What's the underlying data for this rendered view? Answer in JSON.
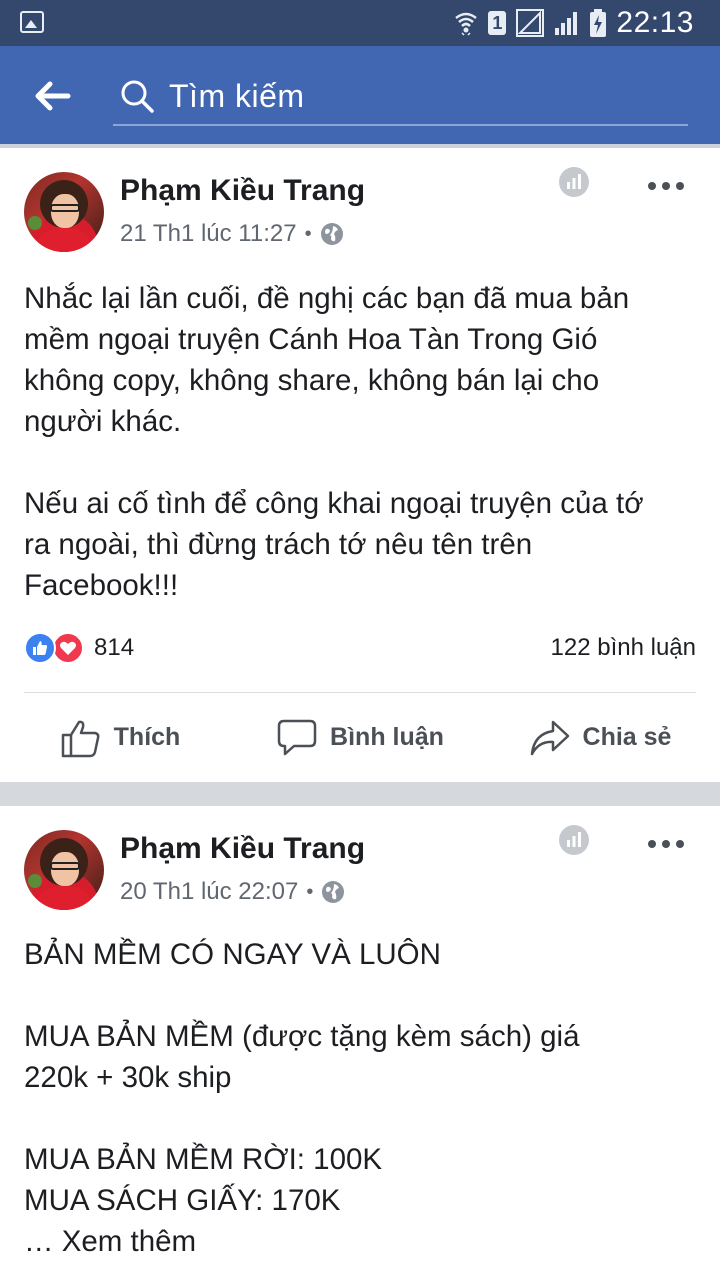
{
  "status_bar": {
    "time": "22:13",
    "sim_label": "1",
    "icons": [
      "gallery-icon",
      "wifi-icon",
      "sim-icon",
      "signal-icon",
      "signal-icon",
      "battery-charging-icon"
    ]
  },
  "header": {
    "back_icon": "arrow-left-icon",
    "search_icon": "search-icon",
    "search_placeholder": "Tìm kiếm"
  },
  "posts": [
    {
      "author": "Phạm Kiều Trang",
      "timestamp": "21 Th1 lúc 11:27",
      "separator": "•",
      "privacy_icon": "globe-icon",
      "text": "Nhắc lại lần cuối, đề nghị các bạn đã mua bản\nmềm ngoại truyện Cánh Hoa Tàn Trong Gió\nkhông copy, không share, không bán lại cho\nngười khác.\n\nNếu ai cố tình để công khai ngoại truyện của tớ\nra ngoài, thì đừng trách tớ nêu tên trên\nFacebook!!!",
      "reaction_count": "814",
      "comment_count": "122 bình luận",
      "actions": {
        "like": "Thích",
        "comment": "Bình luận",
        "share": "Chia sẻ"
      }
    },
    {
      "author": "Phạm Kiều Trang",
      "timestamp": "20 Th1 lúc 22:07",
      "separator": "•",
      "privacy_icon": "globe-icon",
      "text": "BẢN MỀM CÓ NGAY VÀ LUÔN\n\nMUA BẢN MỀM (được tặng kèm sách) giá\n220k + 30k ship\n\nMUA BẢN MỀM RỜI: 100K\nMUA SÁCH GIẤY: 170K",
      "see_more": "… Xem thêm"
    }
  ],
  "colors": {
    "status_bar": "#34486d",
    "header": "#4267b2",
    "like_reaction": "#3b82f0",
    "love_reaction": "#f0384e"
  }
}
